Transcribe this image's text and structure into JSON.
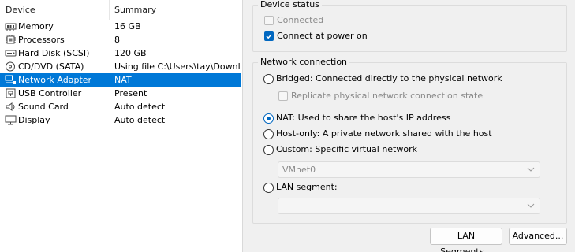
{
  "device_list": {
    "columns": {
      "device": "Device",
      "summary": "Summary"
    },
    "rows": [
      {
        "name": "Memory",
        "summary": "16 GB",
        "icon": "memory-icon"
      },
      {
        "name": "Processors",
        "summary": "8",
        "icon": "processor-icon"
      },
      {
        "name": "Hard Disk (SCSI)",
        "summary": "120 GB",
        "icon": "hard-disk-icon"
      },
      {
        "name": "CD/DVD (SATA)",
        "summary": "Using file C:\\Users\\tay\\Downl...",
        "icon": "cd-dvd-icon"
      },
      {
        "name": "Network Adapter",
        "summary": "NAT",
        "icon": "network-adapter-icon",
        "selected": true
      },
      {
        "name": "USB Controller",
        "summary": "Present",
        "icon": "usb-icon"
      },
      {
        "name": "Sound Card",
        "summary": "Auto detect",
        "icon": "sound-card-icon"
      },
      {
        "name": "Display",
        "summary": "Auto detect",
        "icon": "display-icon"
      }
    ]
  },
  "device_status": {
    "title": "Device status",
    "connected": {
      "label": "Connected",
      "checked": false,
      "enabled": false
    },
    "connect_at_power_on": {
      "label": "Connect at power on",
      "checked": true,
      "enabled": true
    }
  },
  "network_connection": {
    "title": "Network connection",
    "bridged": {
      "label": "Bridged: Connected directly to the physical network",
      "selected": false
    },
    "replicate": {
      "label": "Replicate physical network connection state",
      "checked": false,
      "enabled": false
    },
    "nat": {
      "label": "NAT: Used to share the host's IP address",
      "selected": true
    },
    "host_only": {
      "label": "Host-only: A private network shared with the host",
      "selected": false
    },
    "custom": {
      "label": "Custom: Specific virtual network",
      "selected": false
    },
    "custom_network_value": "VMnet0",
    "lan_segment": {
      "label": "LAN segment:",
      "selected": false
    },
    "lan_segment_value": ""
  },
  "buttons": {
    "lan_segments": "LAN Segments...",
    "advanced": "Advanced..."
  },
  "colors": {
    "selection": "#0078d7",
    "accent": "#0067c0",
    "panel_bg": "#f0f0f0"
  }
}
